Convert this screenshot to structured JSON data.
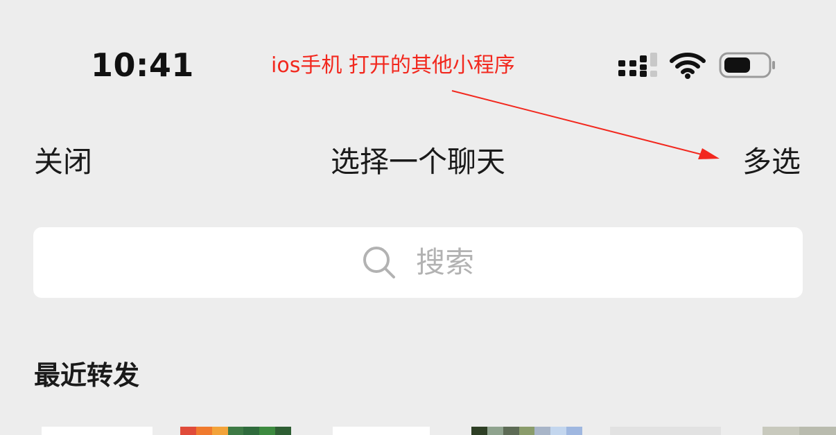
{
  "status_bar": {
    "time": "10:41",
    "icons": [
      "signal-icon",
      "wifi-icon",
      "battery-icon"
    ]
  },
  "annotation": {
    "text": "ios手机 打开的其他小程序",
    "color": "#F2281E"
  },
  "nav": {
    "close_label": "关闭",
    "title": "选择一个聊天",
    "multi_select_label": "多选"
  },
  "search": {
    "placeholder": "搜索"
  },
  "recent": {
    "section_title": "最近转发",
    "avatars": [
      {
        "colors": [
          "#FFFFFF"
        ]
      },
      {
        "colors": [
          "#E04B3A",
          "#F07A2E",
          "#F3A33A",
          "#3E7A45",
          "#2F6B3C",
          "#3C8A3F",
          "#2E5E33"
        ]
      },
      {
        "colors": [
          "#FFFFFF"
        ]
      },
      {
        "colors": [
          "#2E3F25",
          "#8FA38E",
          "#5D6B55",
          "#8A9C6B",
          "#A8B5C8",
          "#C3D6EE",
          "#9FB7E0"
        ]
      },
      {
        "colors": [
          "#E2E2E2"
        ]
      },
      {
        "colors": [
          "#C8C9BD",
          "#B9BBAE"
        ]
      }
    ]
  },
  "colors": {
    "background": "#EDEDED",
    "search_background": "#FFFFFF",
    "placeholder": "#B2B2B2",
    "text": "#1A1A1A"
  }
}
